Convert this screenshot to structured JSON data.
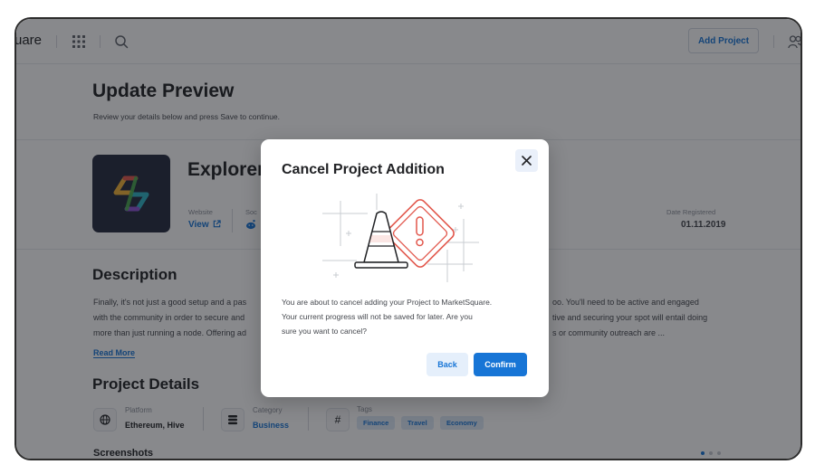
{
  "nav": {
    "brand": "uare",
    "add_project_label": "Add Project",
    "icons": [
      "grid-icon",
      "search-icon",
      "users-icon"
    ]
  },
  "header": {
    "title": "Update Preview",
    "subtitle": "Review your details below and press Save to continue."
  },
  "project": {
    "name": "Explorer",
    "website_label": "Website",
    "website_link": "View",
    "social_label": "Soc",
    "date_label": "Date Registered",
    "date_value": "01.11.2019"
  },
  "description": {
    "title": "Description",
    "left_lines": [
      "Finally, it's not just a good setup and a pas",
      "with the community in order to secure and",
      "more than just running a node. Offering ad"
    ],
    "right_lines": [
      "oo. You'll need to be active and engaged",
      "tive and securing your spot will entail doing",
      "s or community outreach are ..."
    ],
    "read_more": "Read More"
  },
  "details": {
    "title": "Project Details",
    "platform_label": "Platform",
    "platform_value": "Ethereum, Hive",
    "category_label": "Category",
    "category_value": "Business",
    "tags_label": "Tags",
    "tags": [
      "Finance",
      "Travel",
      "Economy"
    ],
    "screenshots_title": "Screenshots"
  },
  "modal": {
    "title": "Cancel Project Addition",
    "body_lines": [
      "You are about to cancel adding your Project to MarketSquare.",
      "Your current progress will not be saved for later. Are you",
      "sure you want to cancel?"
    ],
    "back_label": "Back",
    "confirm_label": "Confirm"
  },
  "colors": {
    "accent": "#1775d6",
    "warning": "#e2574c",
    "overlay": "rgba(18,20,26,0.5)"
  }
}
